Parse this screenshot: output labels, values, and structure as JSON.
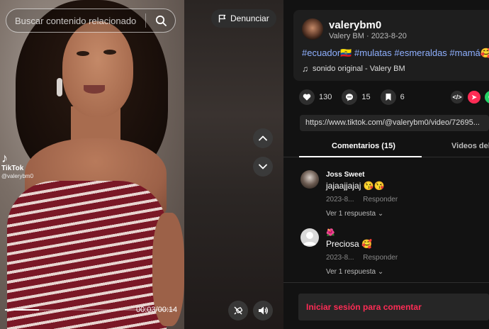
{
  "search": {
    "placeholder": "Buscar contenido relacionado"
  },
  "report": {
    "label": "Denunciar"
  },
  "player": {
    "watermark_brand": "TikTok",
    "watermark_user": "@valerybm0",
    "time": "00:03/00:14",
    "progress_fraction": 0.2
  },
  "author": {
    "handle": "valerybm0",
    "meta": "Valery BM · 2023-8-20",
    "hashtags": "#ecuador🇪🇨 #mulatas #esmeraldas #mamá🥰",
    "sound": "sonido original - Valery BM"
  },
  "actions": {
    "likes": "130",
    "comments": "15",
    "saves": "6"
  },
  "share_url": "https://www.tiktok.com/@valerybm0/video/72695...",
  "tabs": {
    "comments": "Comentarios (15)",
    "videos": "Videos del"
  },
  "comments": [
    {
      "name": "Joss Sweet",
      "text": "jajaajjajaj 😘😘",
      "date": "2023-8...",
      "reply": "Responder",
      "more": "Ver 1 respuesta"
    },
    {
      "name": "🌺",
      "text": "Preciosa 🥰",
      "date": "2023-8...",
      "reply": "Responder",
      "more": "Ver 1 respuesta"
    }
  ],
  "login": {
    "label": "Iniciar sesión para comentar"
  },
  "colors": {
    "accent": "#fe2c55",
    "hashtag": "#8fb0ff",
    "panel_bg": "#121212",
    "card_bg": "#1e1e1e"
  }
}
